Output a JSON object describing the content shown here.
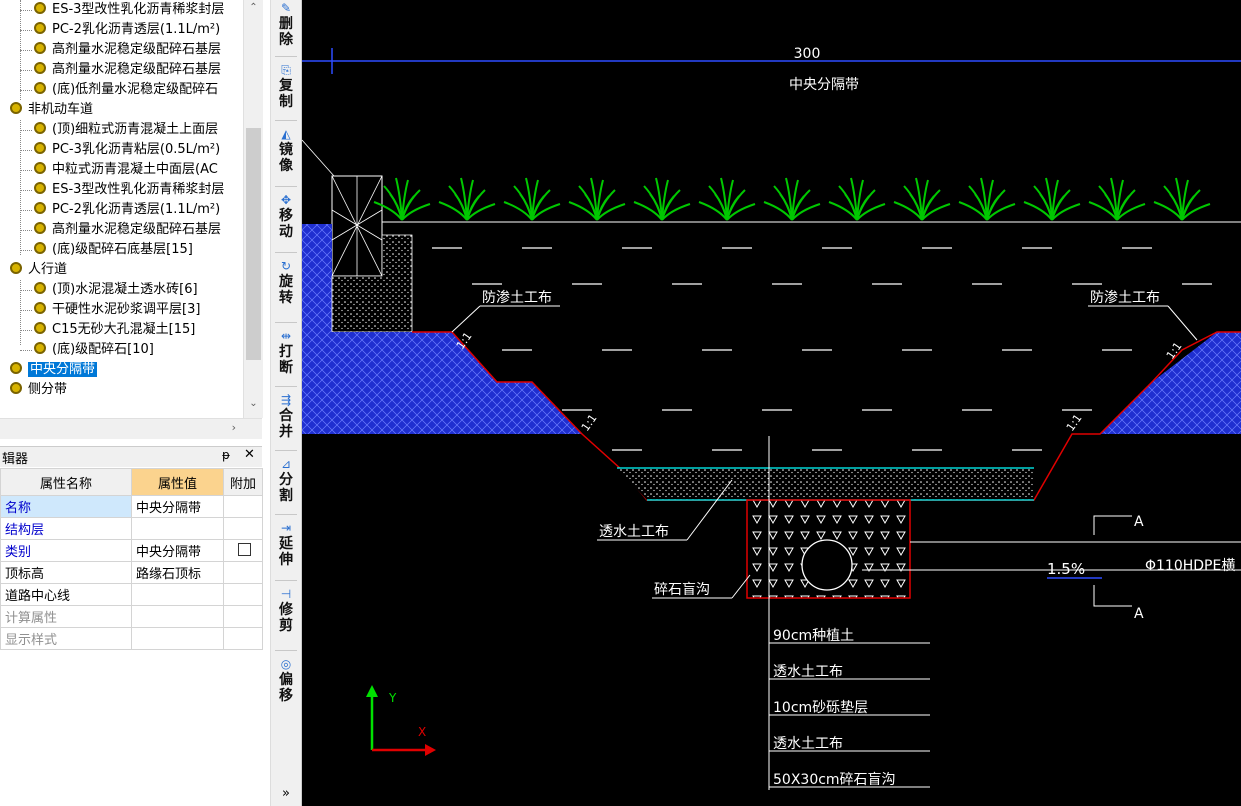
{
  "tree": {
    "items": [
      {
        "label": "ES-3型改性乳化沥青稀浆封层",
        "level": 2
      },
      {
        "label": "PC-2乳化沥青透层(1.1L/m²)",
        "level": 2
      },
      {
        "label": "高剂量水泥稳定级配碎石基层",
        "level": 2
      },
      {
        "label": "高剂量水泥稳定级配碎石基层",
        "level": 2
      },
      {
        "label": "(底)低剂量水泥稳定级配碎石",
        "level": 2
      },
      {
        "label": "非机动车道",
        "level": 1
      },
      {
        "label": "(顶)细粒式沥青混凝土上面层",
        "level": 2
      },
      {
        "label": "PC-3乳化沥青粘层(0.5L/m²)",
        "level": 2
      },
      {
        "label": "中粒式沥青混凝土中面层(AC",
        "level": 2
      },
      {
        "label": "ES-3型改性乳化沥青稀浆封层",
        "level": 2
      },
      {
        "label": "PC-2乳化沥青透层(1.1L/m²)",
        "level": 2
      },
      {
        "label": "高剂量水泥稳定级配碎石基层",
        "level": 2
      },
      {
        "label": "(底)级配碎石底基层[15]",
        "level": 2
      },
      {
        "label": "人行道",
        "level": 1
      },
      {
        "label": "(顶)水泥混凝土透水砖[6]",
        "level": 2
      },
      {
        "label": "干硬性水泥砂浆调平层[3]",
        "level": 2
      },
      {
        "label": "C15无砂大孔混凝土[15]",
        "level": 2
      },
      {
        "label": "(底)级配碎石[10]",
        "level": 2
      },
      {
        "label": "中央分隔带",
        "level": 1,
        "selected": true
      },
      {
        "label": "侧分带",
        "level": 1
      }
    ]
  },
  "props": {
    "panel_title": "辑器",
    "pin": "ᵽ",
    "close": "✕",
    "headers": {
      "name": "属性名称",
      "value": "属性值",
      "extra": "附加"
    },
    "rows": [
      {
        "name": "名称",
        "value": "中央分隔带",
        "style": "blue",
        "checkbox": false
      },
      {
        "name": "结构层",
        "value": "",
        "style": "blue",
        "checkbox": false
      },
      {
        "name": "类别",
        "value": "中央分隔带",
        "style": "blue",
        "checkbox": true
      },
      {
        "name": "顶标高",
        "value": "路缘石顶标",
        "style": "normal",
        "checkbox": false
      },
      {
        "name": "道路中心线",
        "value": "",
        "style": "normal",
        "checkbox": false
      },
      {
        "name": "计算属性",
        "value": "",
        "style": "gray",
        "checkbox": false
      },
      {
        "name": "显示样式",
        "value": "",
        "style": "gray",
        "checkbox": false
      }
    ]
  },
  "toolbar": {
    "tools": [
      {
        "label": "删除",
        "icon": "delete-icon"
      },
      {
        "label": "复制",
        "icon": "copy-icon"
      },
      {
        "label": "镜像",
        "icon": "mirror-icon"
      },
      {
        "label": "移动",
        "icon": "move-icon"
      },
      {
        "label": "旋转",
        "icon": "rotate-icon"
      },
      {
        "label": "打断",
        "icon": "break-icon"
      },
      {
        "label": "合并",
        "icon": "merge-icon"
      },
      {
        "label": "分割",
        "icon": "split-icon"
      },
      {
        "label": "延伸",
        "icon": "extend-icon"
      },
      {
        "label": "修剪",
        "icon": "trim-icon"
      },
      {
        "label": "偏移",
        "icon": "offset-icon"
      }
    ],
    "more": "»"
  },
  "drawing": {
    "dimension": "300",
    "median_label": "中央分隔带",
    "fabric_left": "防渗土工布",
    "fabric_right": "防渗土工布",
    "slope": "1:1",
    "permeable_fabric": "透水土工布",
    "gravel_drain": "碎石盲沟",
    "section_mark": "A",
    "grade": "1.5%",
    "pipe": "Φ110HDPE横",
    "legend": [
      "90cm种植土",
      "透水土工布",
      "10cm砂砾垫层",
      "透水土工布",
      "50X30cm碎石盲沟"
    ],
    "axis_x": "X",
    "axis_y": "Y",
    "colors": {
      "background": "#000000",
      "outline_red": "#e00000",
      "fill_blue": "#1f2fd0",
      "plant_green": "#00c800",
      "cyan": "#00ffff",
      "white": "#ffffff"
    }
  }
}
